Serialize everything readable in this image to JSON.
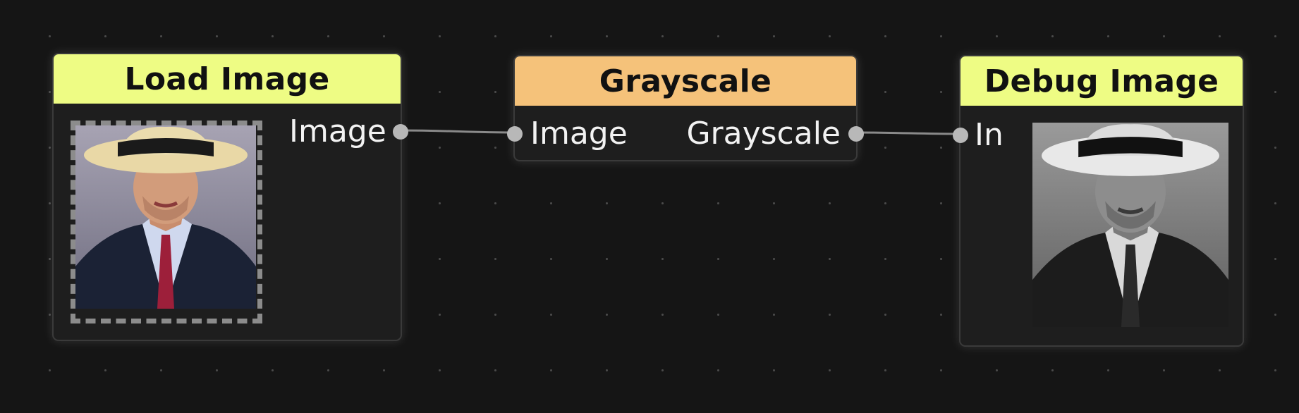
{
  "nodes": {
    "load_image": {
      "title": "Load Image",
      "output_label": "Image"
    },
    "grayscale": {
      "title": "Grayscale",
      "input_label": "Image",
      "output_label": "Grayscale"
    },
    "debug_image": {
      "title": "Debug Image",
      "input_label": "In"
    }
  },
  "colors": {
    "canvas_bg": "#151515",
    "node_bg": "#1e1e1e",
    "header_yellow": "#eefc84",
    "header_orange": "#f5c27a",
    "port": "#b8b8b8",
    "wire": "#8a8a8a"
  },
  "icons": {
    "port": "circle",
    "photo_color": "man-in-fedora-photo",
    "photo_gray": "man-in-fedora-photo-grayscale"
  }
}
